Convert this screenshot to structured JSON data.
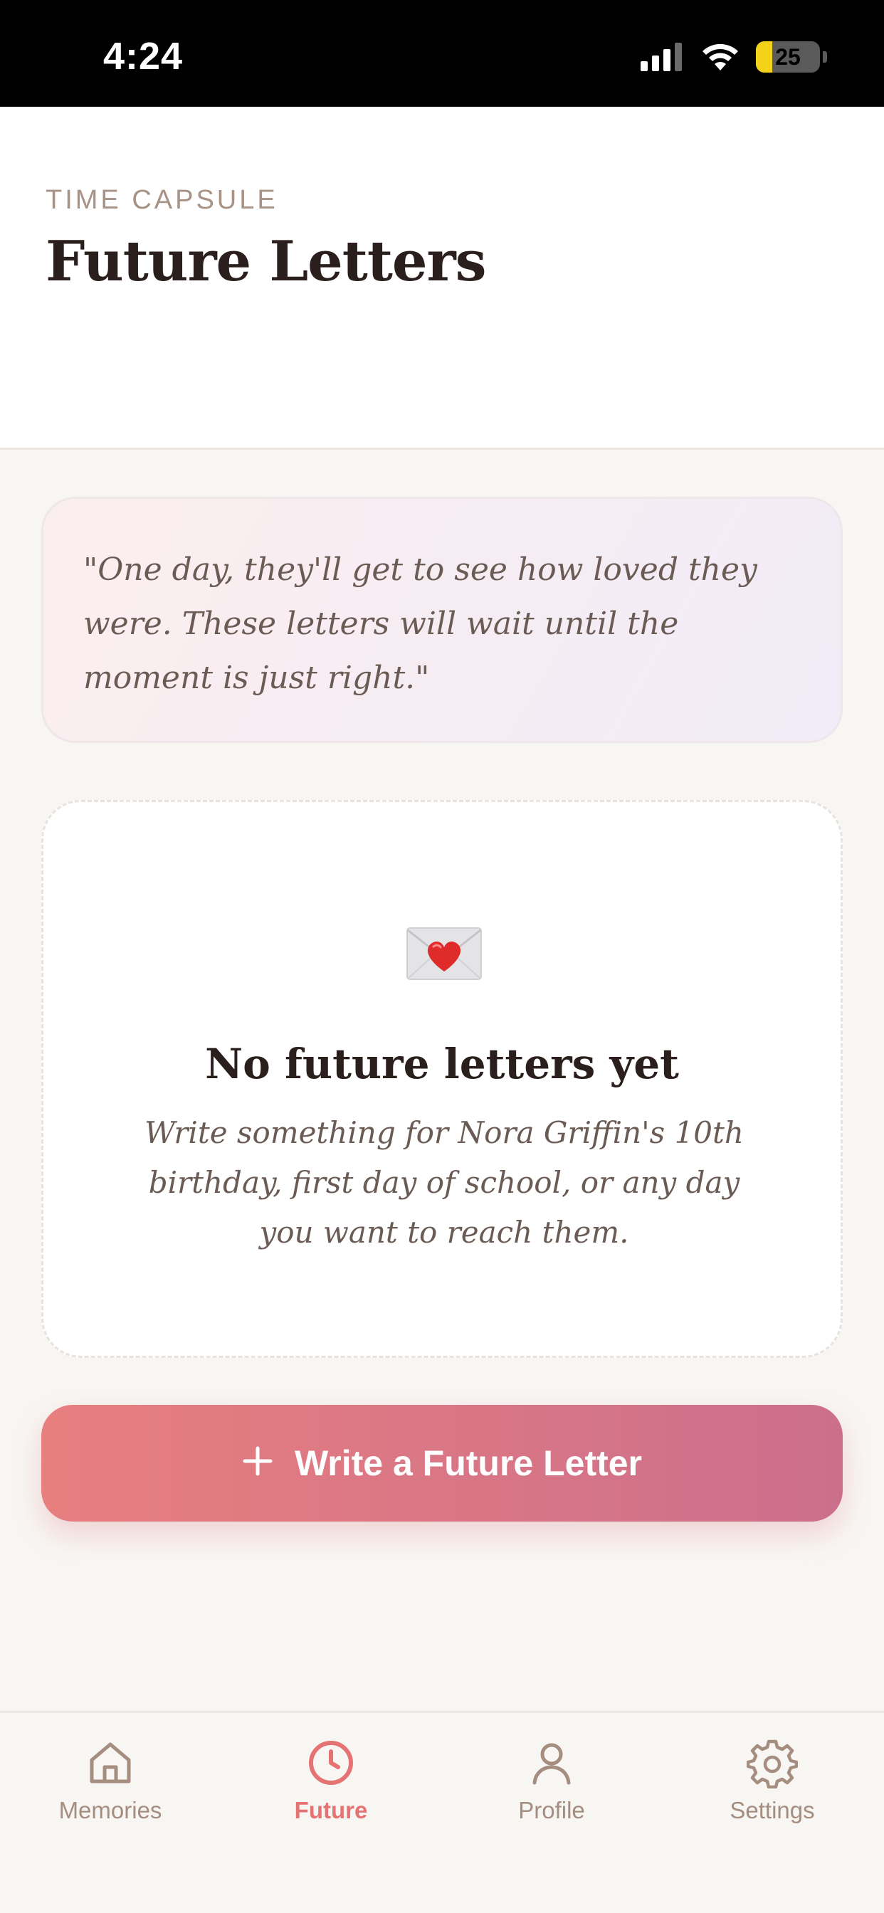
{
  "status_bar": {
    "time": "4:24",
    "battery": "25"
  },
  "header": {
    "eyebrow": "TIME CAPSULE",
    "title": "Future Letters"
  },
  "quote": {
    "text": "\"One day, they'll get to see how loved they were. These letters will wait until the moment is just right.\""
  },
  "empty_state": {
    "icon": "love-letter-icon",
    "title": "No future letters yet",
    "description": "Write something for Nora Griffin's 10th birthday, first day of school, or any day you want to reach them."
  },
  "cta": {
    "icon": "plus-icon",
    "label": "Write a Future Letter"
  },
  "nav": {
    "items": [
      {
        "icon": "home-icon",
        "label": "Memories",
        "active": false
      },
      {
        "icon": "clock-icon",
        "label": "Future",
        "active": true
      },
      {
        "icon": "person-icon",
        "label": "Profile",
        "active": false
      },
      {
        "icon": "gear-icon",
        "label": "Settings",
        "active": false
      }
    ]
  },
  "colors": {
    "accent": "#e57373",
    "nav_inactive": "#a58d80",
    "background": "#f8f6f3"
  }
}
